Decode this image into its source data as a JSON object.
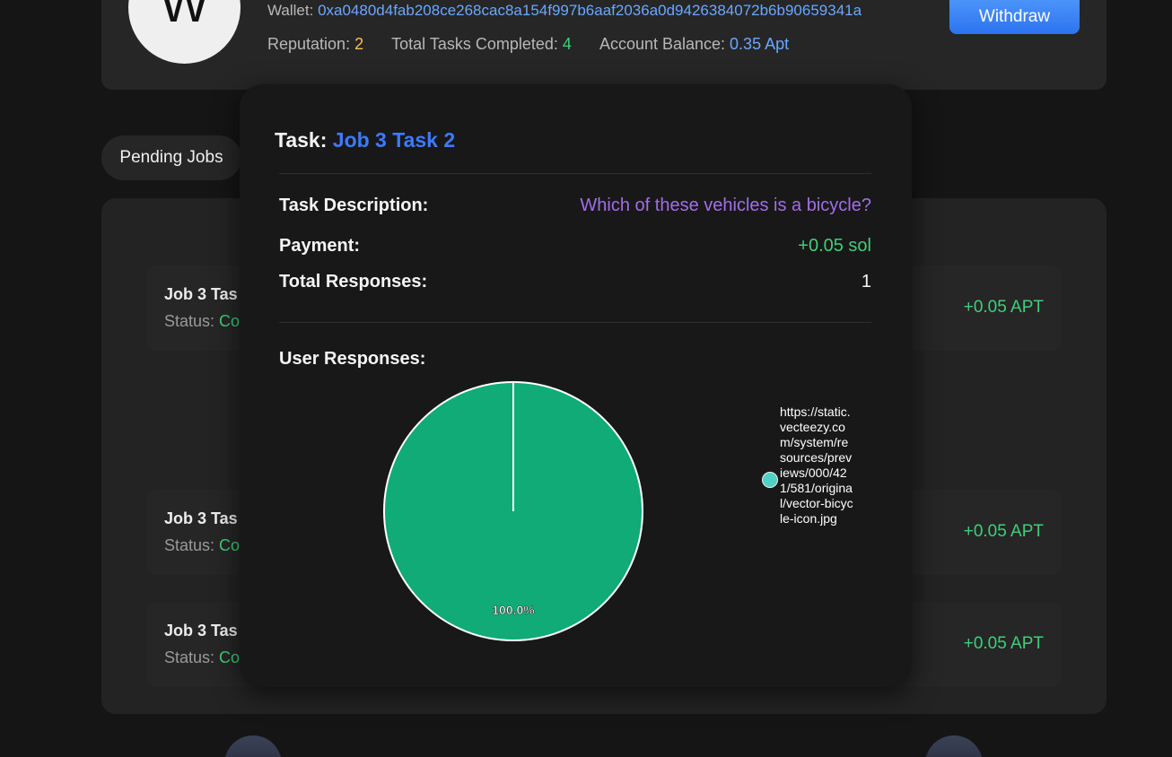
{
  "profile": {
    "avatar_letter": "W",
    "wallet_label": "Wallet:",
    "wallet_address": "0xa0480d4fab208ce268cac8a154f997b6aaf2036a0d9426384072b6b90659341a",
    "reputation_label": "Reputation:",
    "reputation_value": "2",
    "tasks_label": "Total Tasks Completed:",
    "tasks_value": "4",
    "balance_label": "Account Balance:",
    "balance_value": "0.35 Apt",
    "withdraw_label": "Withdraw"
  },
  "tabs": {
    "pending_label": "Pending Jobs"
  },
  "jobs": [
    {
      "title": "Job 3 Tas",
      "status_label": "Status:",
      "status": "Co",
      "payment": "+0.05 APT"
    },
    {
      "title": "Job 3 Tas",
      "status_label": "Status:",
      "status": "Co",
      "payment": "+0.05 APT"
    },
    {
      "title": "Job 3 Tas",
      "status_label": "Status:",
      "status": "Co",
      "payment": "+0.05 APT"
    }
  ],
  "modal": {
    "task_prefix": "Task:",
    "task_name": "Job 3 Task 2",
    "description_label": "Task Description:",
    "description_value": "Which of these vehicles is a bicycle?",
    "payment_label": "Payment:",
    "payment_value": "+0.05 sol",
    "responses_label": "Total Responses:",
    "responses_value": "1",
    "user_responses_label": "User Responses:"
  },
  "chart_data": {
    "type": "pie",
    "categories": [
      "https://static.vecteezy.com/system/resources/previews/000/421/581/original/vector-bicycle-icon.jpg"
    ],
    "values": [
      100
    ],
    "slice_labels": [
      "100.0%"
    ],
    "colors": {
      "slice": "#10ab76",
      "legend_marker": "#4fd1c5",
      "stroke": "#ffffff"
    },
    "legend": "right"
  },
  "colors": {
    "accent_blue": "#3b7bff",
    "success_green": "#3ed07a",
    "purple": "#a26ee8",
    "reputation_yellow": "#f5c15a"
  }
}
